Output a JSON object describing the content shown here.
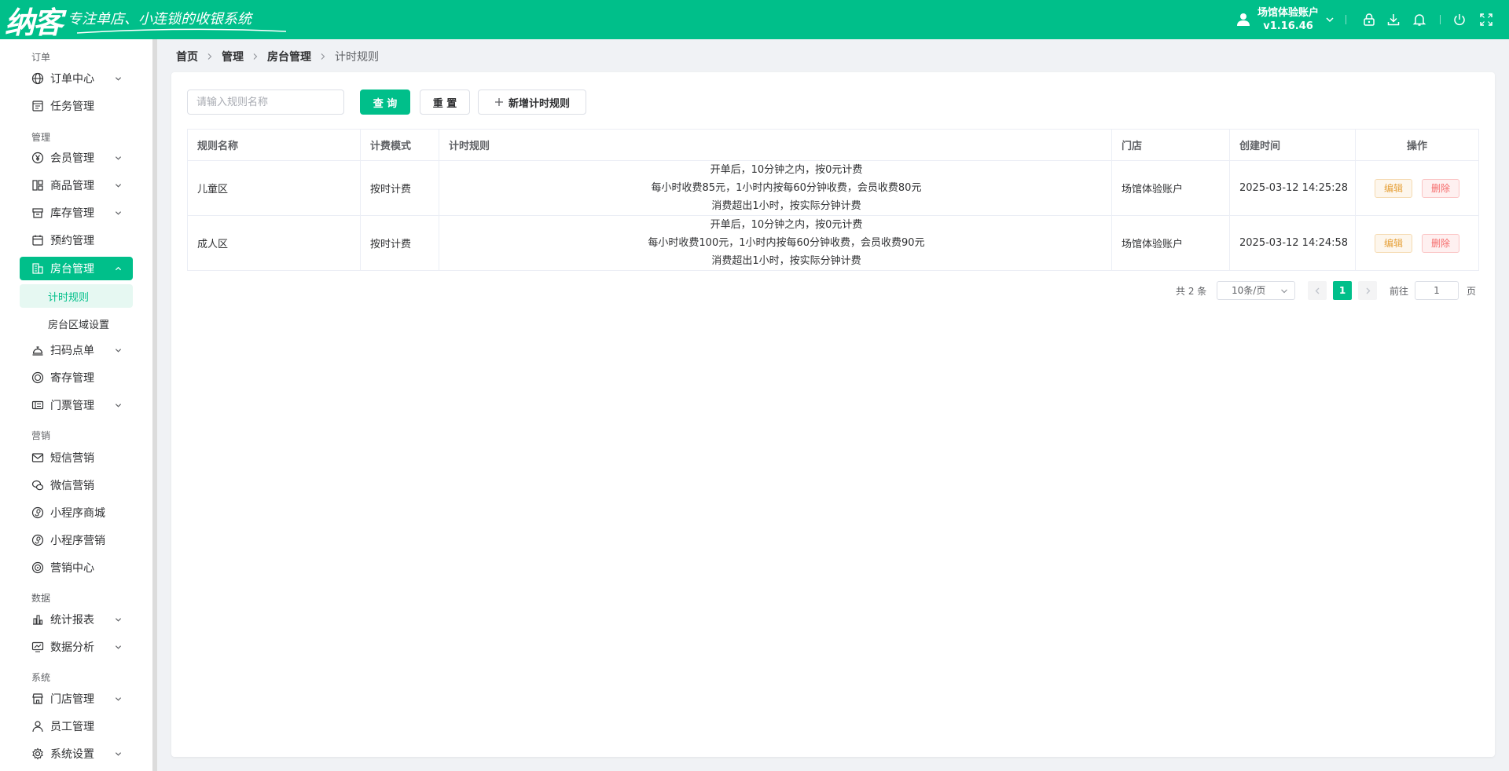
{
  "app": {
    "logo_text": "纳客",
    "slogan": "专注单店、小连锁的收银系统"
  },
  "header": {
    "account_name": "场馆体验账户",
    "version": "v1.16.46"
  },
  "sidebar": {
    "groups": {
      "order": "订单",
      "manage": "管理",
      "marketing": "营销",
      "data": "数据",
      "system": "系统"
    },
    "items": {
      "order_center": "订单中心",
      "task_manage": "任务管理",
      "member_manage": "会员管理",
      "goods_manage": "商品管理",
      "stock_manage": "库存管理",
      "booking_manage": "预约管理",
      "room_manage": "房台管理",
      "timing_rules": "计时规则",
      "room_area": "房台区域设置",
      "qr_order": "扫码点单",
      "deposit_manage": "寄存管理",
      "ticket_manage": "门票管理",
      "sms_marketing": "短信营销",
      "wechat_marketing": "微信营销",
      "mini_mall": "小程序商城",
      "mini_marketing": "小程序营销",
      "marketing_center": "营销中心",
      "stats_report": "统计报表",
      "data_analysis": "数据分析",
      "store_manage": "门店管理",
      "staff_manage": "员工管理",
      "system_settings": "系统设置"
    }
  },
  "breadcrumb": [
    "首页",
    "管理",
    "房台管理",
    "计时规则"
  ],
  "toolbar": {
    "search_placeholder": "请输入规则名称",
    "query_label": "查 询",
    "reset_label": "重 置",
    "add_label": "新增计时规则"
  },
  "table": {
    "headers": {
      "name": "规则名称",
      "mode": "计费模式",
      "rule": "计时规则",
      "store": "门店",
      "created": "创建时间",
      "actions": "操作"
    },
    "rows": [
      {
        "name": "儿童区",
        "mode": "按时计费",
        "rule_lines": [
          "开单后，10分钟之内，按0元计费",
          "每小时收费85元，1小时内按每60分钟收费，会员收费80元",
          "消费超出1小时，按实际分钟计费"
        ],
        "store": "场馆体验账户",
        "created": "2025-03-12 14:25:28",
        "edit": "编辑",
        "delete": "删除"
      },
      {
        "name": "成人区",
        "mode": "按时计费",
        "rule_lines": [
          "开单后，10分钟之内，按0元计费",
          "每小时收费100元，1小时内按每60分钟收费，会员收费90元",
          "消费超出1小时，按实际分钟计费"
        ],
        "store": "场馆体验账户",
        "created": "2025-03-12 14:24:58",
        "edit": "编辑",
        "delete": "删除"
      }
    ]
  },
  "pagination": {
    "total": "共 2 条",
    "page_size": "10条/页",
    "current_page": "1",
    "goto_label": "前往",
    "goto_value": "1",
    "page_unit": "页"
  },
  "colors": {
    "brand": "#00bf8a",
    "edit": "#e6a23c",
    "delete": "#f56c6c"
  }
}
